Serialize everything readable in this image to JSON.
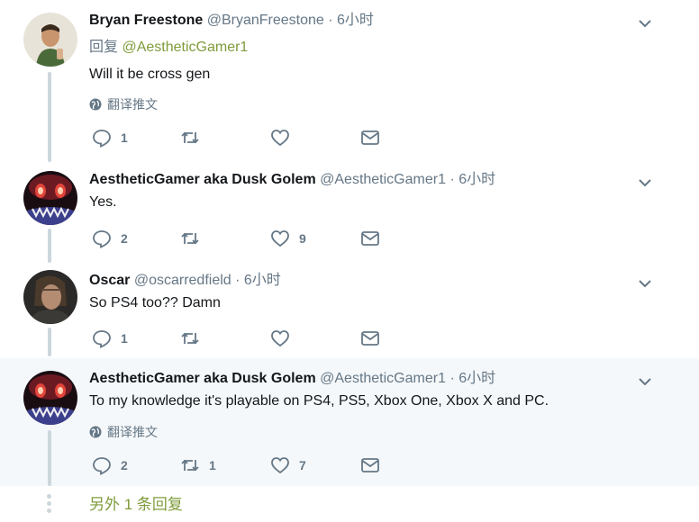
{
  "tweets": [
    {
      "fullname": "Bryan Freestone",
      "username": "@BryanFreestone",
      "separator": "·",
      "time": "6小时",
      "reply_label": "回复",
      "reply_to": "@AestheticGamer1",
      "text": "Will it be cross gen",
      "translate": "翻译推文",
      "reply_count": "1",
      "retweet_count": "",
      "like_count": ""
    },
    {
      "fullname": "AestheticGamer aka Dusk Golem",
      "username": "@AestheticGamer1",
      "separator": "·",
      "time": "6小时",
      "text": "Yes.",
      "reply_count": "2",
      "retweet_count": "",
      "like_count": "9"
    },
    {
      "fullname": "Oscar",
      "username": "@oscarredfield",
      "separator": "·",
      "time": "6小时",
      "text": "So PS4 too?? Damn",
      "reply_count": "1",
      "retweet_count": "",
      "like_count": ""
    },
    {
      "fullname": "AestheticGamer aka Dusk Golem",
      "username": "@AestheticGamer1",
      "separator": "·",
      "time": "6小时",
      "text": "To my knowledge it's playable on PS4, PS5, Xbox One, Xbox X and PC.",
      "translate": "翻译推文",
      "reply_count": "2",
      "retweet_count": "1",
      "like_count": "7"
    }
  ],
  "more_replies": "另外 1 条回复",
  "colors": {
    "link": "#7f9c3c",
    "muted": "#657786",
    "thread": "#ccd6dd",
    "highlight_bg": "#f5f8fa"
  },
  "icons": [
    "avatar-man-photo",
    "avatar-dusk-golem",
    "avatar-oscar",
    "globe-icon",
    "chevron-down-icon",
    "reply-icon",
    "retweet-icon",
    "like-icon",
    "message-icon"
  ]
}
